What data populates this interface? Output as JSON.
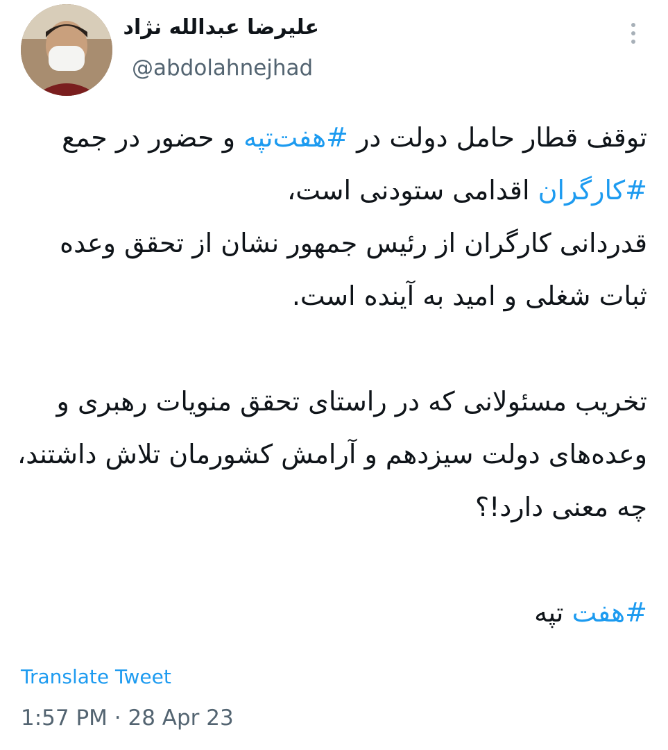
{
  "tweet": {
    "author": {
      "display_name": "علیرضا عبدالله نژاد",
      "handle": "@abdolahnejhad",
      "avatar_icon": "user-avatar"
    },
    "more_icon": "more-options-icon",
    "paragraph1": {
      "p1": "توقف قطار حامل دولت در ",
      "tag1": "#هفت‌تپه",
      "p2": " و حضور در جمع ",
      "tag2": "#کارگران",
      "p3": " اقدامی ستودنی است،",
      "line2": "قدردانی کارگران از رئیس جمهور نشان از تحقق وعده ثبات شغلی و امید به آینده است."
    },
    "paragraph2": "تخریب مسئولانی که در راستای تحقق منویات رهبری و وعده‌های دولت سیزدهم و آرامش کشورمان تلاش داشتند، چه معنی دارد!؟",
    "paragraph3": {
      "tag": "#هفت",
      "rest": " تپه"
    },
    "translate_label": "Translate Tweet",
    "timestamp": "1:57 PM · 28 Apr 23"
  },
  "colors": {
    "link": "#1d9bf0",
    "secondary_text": "#536471",
    "primary_text": "#0f1419"
  }
}
